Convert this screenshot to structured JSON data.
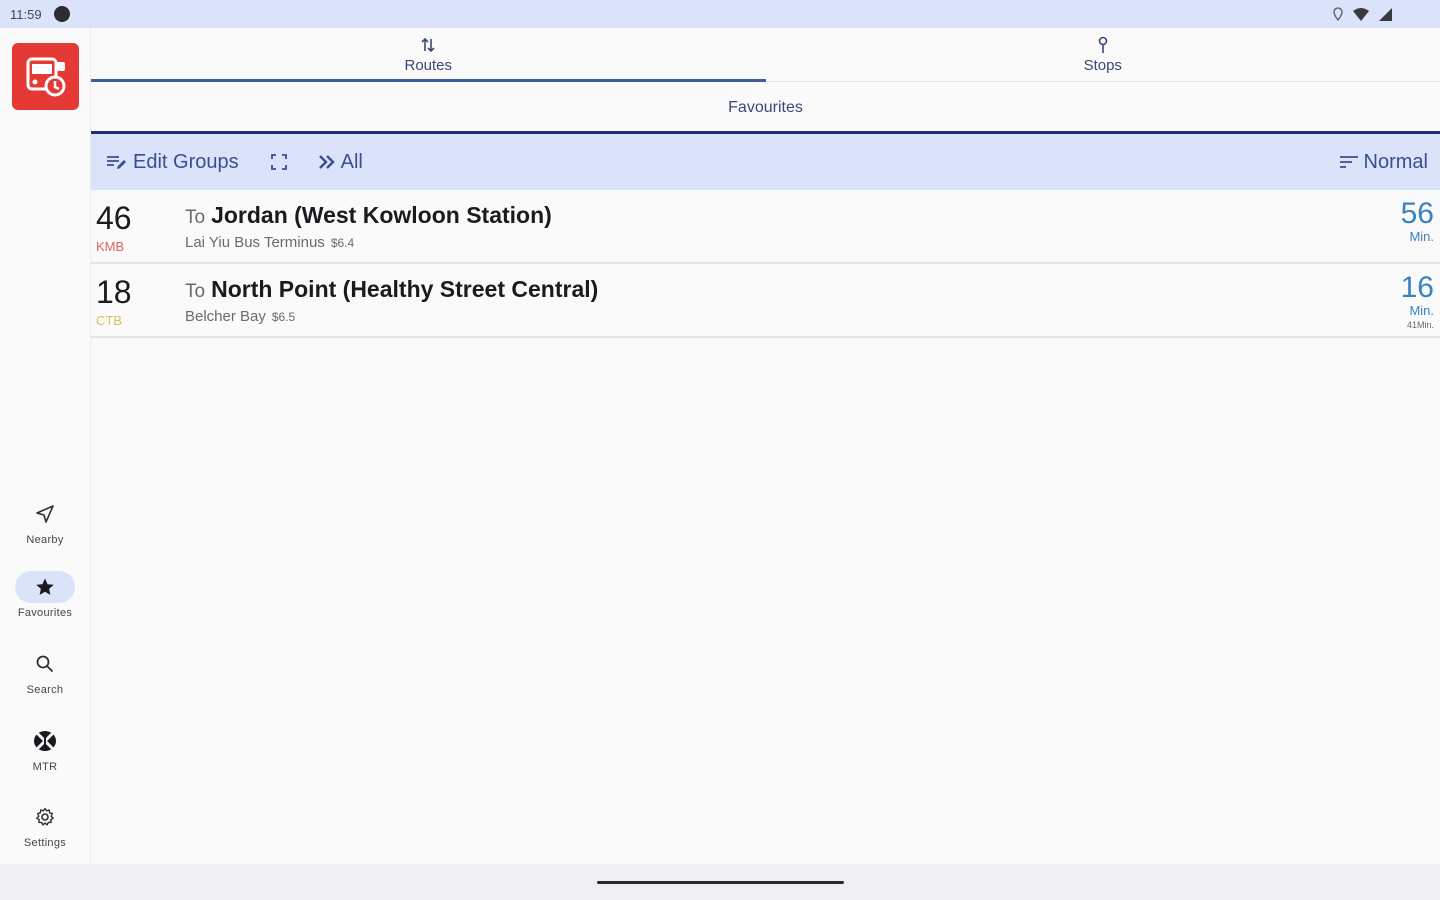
{
  "status_bar": {
    "time": "11:59",
    "icons": [
      "location-icon",
      "wifi-icon",
      "signal-icon"
    ]
  },
  "app": {
    "logo_icon": "bus-logo-icon",
    "brand_color": "#e53935"
  },
  "rail": {
    "items": [
      {
        "label": "Nearby",
        "icon": "navigation-arrow-icon"
      },
      {
        "label": "Favourites",
        "icon": "star-icon",
        "active": true
      },
      {
        "label": "Search",
        "icon": "search-icon"
      },
      {
        "label": "MTR",
        "icon": "mtr-logo-icon"
      },
      {
        "label": "Settings",
        "icon": "gear-icon"
      }
    ]
  },
  "tabs": [
    {
      "label": "Routes",
      "icon": "swap-vertical-icon",
      "active": true
    },
    {
      "label": "Stops",
      "icon": "pin-icon"
    }
  ],
  "subtab": {
    "label": "Favourites"
  },
  "toolbar": {
    "edit_label": "Edit Groups",
    "all_label": "All",
    "sort_label": "Normal",
    "accent": "#3b4f8f"
  },
  "routes": [
    {
      "number": "46",
      "operator": "KMB",
      "operator_color": "#e0625b",
      "to_prefix": "To",
      "destination": "Jordan (West Kowloon Station)",
      "stop": "Lai Yiu Bus Terminus",
      "fare": "$6.4",
      "eta": "56",
      "eta_unit": "Min.",
      "eta_extra": ""
    },
    {
      "number": "18",
      "operator": "CTB",
      "operator_color": "#d9c25a",
      "to_prefix": "To",
      "destination": "North Point (Healthy Street Central)",
      "stop": "Belcher Bay",
      "fare": "$6.5",
      "eta": "16",
      "eta_unit": "Min.",
      "eta_extra": "41Min."
    }
  ]
}
